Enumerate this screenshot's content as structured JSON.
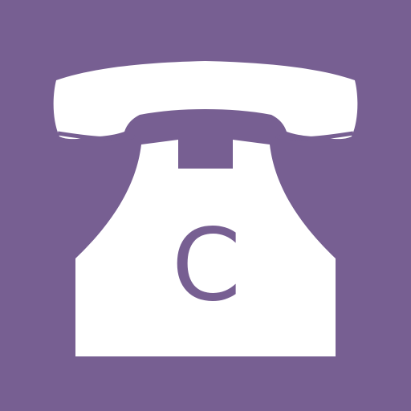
{
  "icon": {
    "name": "telephone-icon",
    "letter": "C",
    "colors": {
      "background": "#775f92",
      "foreground": "#ffffff"
    }
  }
}
